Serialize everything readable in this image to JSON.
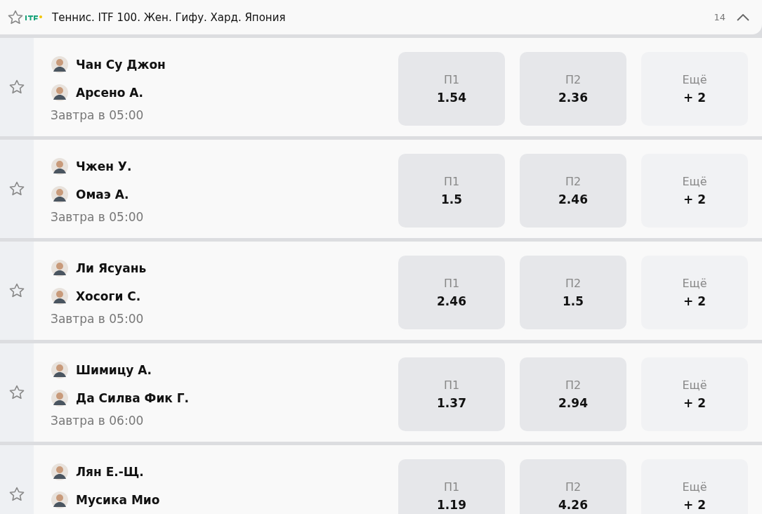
{
  "header": {
    "favorite": false,
    "title": "Теннис. ITF 100. Жен. Гифу. Хард. Япония",
    "count": "14",
    "expanded": true
  },
  "matches": [
    {
      "favorite": false,
      "players": [
        "Чан Су Джон",
        "Арсено А."
      ],
      "time": "Завтра в 05:00",
      "odds": [
        {
          "kind": "odd",
          "label": "П1",
          "value": "1.54"
        },
        {
          "kind": "odd",
          "label": "П2",
          "value": "2.36"
        },
        {
          "kind": "more",
          "label": "Ещё",
          "value": "+ 2"
        }
      ]
    },
    {
      "favorite": false,
      "players": [
        "Чжен У.",
        "Омаэ А."
      ],
      "time": "Завтра в 05:00",
      "odds": [
        {
          "kind": "odd",
          "label": "П1",
          "value": "1.5"
        },
        {
          "kind": "odd",
          "label": "П2",
          "value": "2.46"
        },
        {
          "kind": "more",
          "label": "Ещё",
          "value": "+ 2"
        }
      ]
    },
    {
      "favorite": false,
      "players": [
        "Ли Ясуань",
        "Хосоги С."
      ],
      "time": "Завтра в 05:00",
      "odds": [
        {
          "kind": "odd",
          "label": "П1",
          "value": "2.46"
        },
        {
          "kind": "odd",
          "label": "П2",
          "value": "1.5"
        },
        {
          "kind": "more",
          "label": "Ещё",
          "value": "+ 2"
        }
      ]
    },
    {
      "favorite": false,
      "players": [
        "Шимицу А.",
        "Да Силва Фик Г."
      ],
      "time": "Завтра в 06:00",
      "odds": [
        {
          "kind": "odd",
          "label": "П1",
          "value": "1.37"
        },
        {
          "kind": "odd",
          "label": "П2",
          "value": "2.94"
        },
        {
          "kind": "more",
          "label": "Ещё",
          "value": "+ 2"
        }
      ]
    },
    {
      "favorite": false,
      "players": [
        "Лян Е.-Щ.",
        "Мусика Мио"
      ],
      "odds": [
        {
          "kind": "odd",
          "label": "П1",
          "value": "1.19"
        },
        {
          "kind": "odd",
          "label": "П2",
          "value": "4.26"
        },
        {
          "kind": "more",
          "label": "Ещё",
          "value": "+ 2"
        }
      ]
    }
  ]
}
